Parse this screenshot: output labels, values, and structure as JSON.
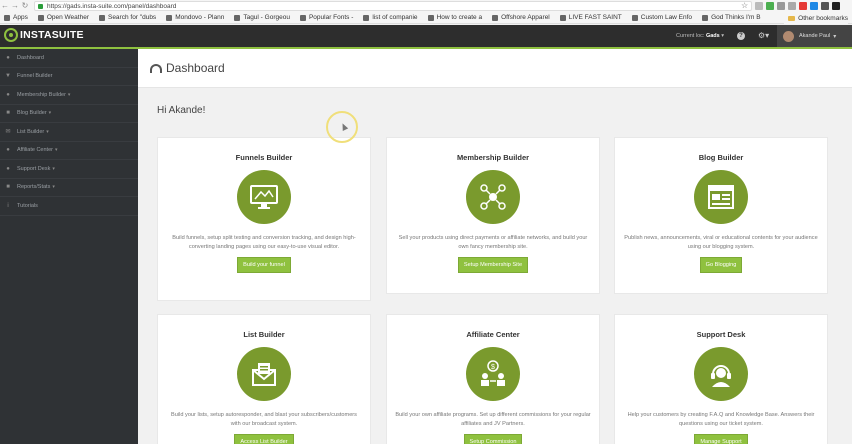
{
  "browser": {
    "url": "https://gads.insta-suite.com/panel/dashboard",
    "bookmarks": [
      "Apps",
      "Open Weather",
      "Search for \"dubs",
      "Mondovo - Plann",
      "Tagul - Gorgeou",
      "Popular Fonts -",
      "list of companie",
      "How to create a",
      "Offshore Apparel",
      "LIVE FAST SAINT",
      "Custom Law Enfo",
      "God Thinks I'm B"
    ],
    "other_bookmarks": "Other bookmarks"
  },
  "header": {
    "logo": "INSTASUITE",
    "current_loc_label": "Current loc:",
    "current_loc_value": "Gads",
    "help_icon": "?",
    "user_name": "Akande Paul"
  },
  "sidebar": {
    "items": [
      {
        "label": "Dashboard",
        "icon": "dashboard-icon"
      },
      {
        "label": "Funnel Builder",
        "icon": "funnel-icon"
      },
      {
        "label": "Membership Builder",
        "icon": "users-icon"
      },
      {
        "label": "Blog Builder",
        "icon": "blog-icon"
      },
      {
        "label": "List Builder",
        "icon": "list-icon"
      },
      {
        "label": "Affiliate Center",
        "icon": "affiliate-icon"
      },
      {
        "label": "Support Desk",
        "icon": "support-icon"
      },
      {
        "label": "Reports/Stats",
        "icon": "reports-icon"
      },
      {
        "label": "Tutorials",
        "icon": "info-icon"
      }
    ]
  },
  "page": {
    "title": "Dashboard",
    "greeting": "Hi Akande!"
  },
  "cards": [
    {
      "title": "Funnels Builder",
      "desc": "Build funnels, setup split testing and conversion tracking, and design high-converting landing pages using our easy-to-use visual editor.",
      "button": "Build your funnel",
      "icon": "monitor-icon"
    },
    {
      "title": "Membership Builder",
      "desc": "Sell your products using direct payments or affiliate networks, and build your own fancy membership site.",
      "button": "Setup Membership Site",
      "icon": "network-icon"
    },
    {
      "title": "Blog Builder",
      "desc": "Publish news, announcements, viral or educational contents for your audience using our blogging system.",
      "button": "Go Blogging",
      "icon": "browser-window-icon"
    },
    {
      "title": "List Builder",
      "desc": "Build your lists, setup autoresponder, and blast your subscribers/customers with our broadcast system.",
      "button": "Access List Builder",
      "icon": "envelope-icon"
    },
    {
      "title": "Affiliate Center",
      "desc": "Build your own affiliate programs. Set up different commissions for your regular affiliates and JV Partners.",
      "button": "Setup Commission",
      "icon": "affiliate-money-icon"
    },
    {
      "title": "Support Desk",
      "desc": "Help your customers by creating F.A.Q and Knowledge Base. Answers their questions using our ticket system.",
      "button": "Manage Support",
      "icon": "headset-icon"
    }
  ],
  "colors": {
    "accent": "#8fc13f",
    "icon_circle": "#7a9a2d",
    "header_bg": "#2d2d2d",
    "sidebar_bg": "#2f3235"
  }
}
